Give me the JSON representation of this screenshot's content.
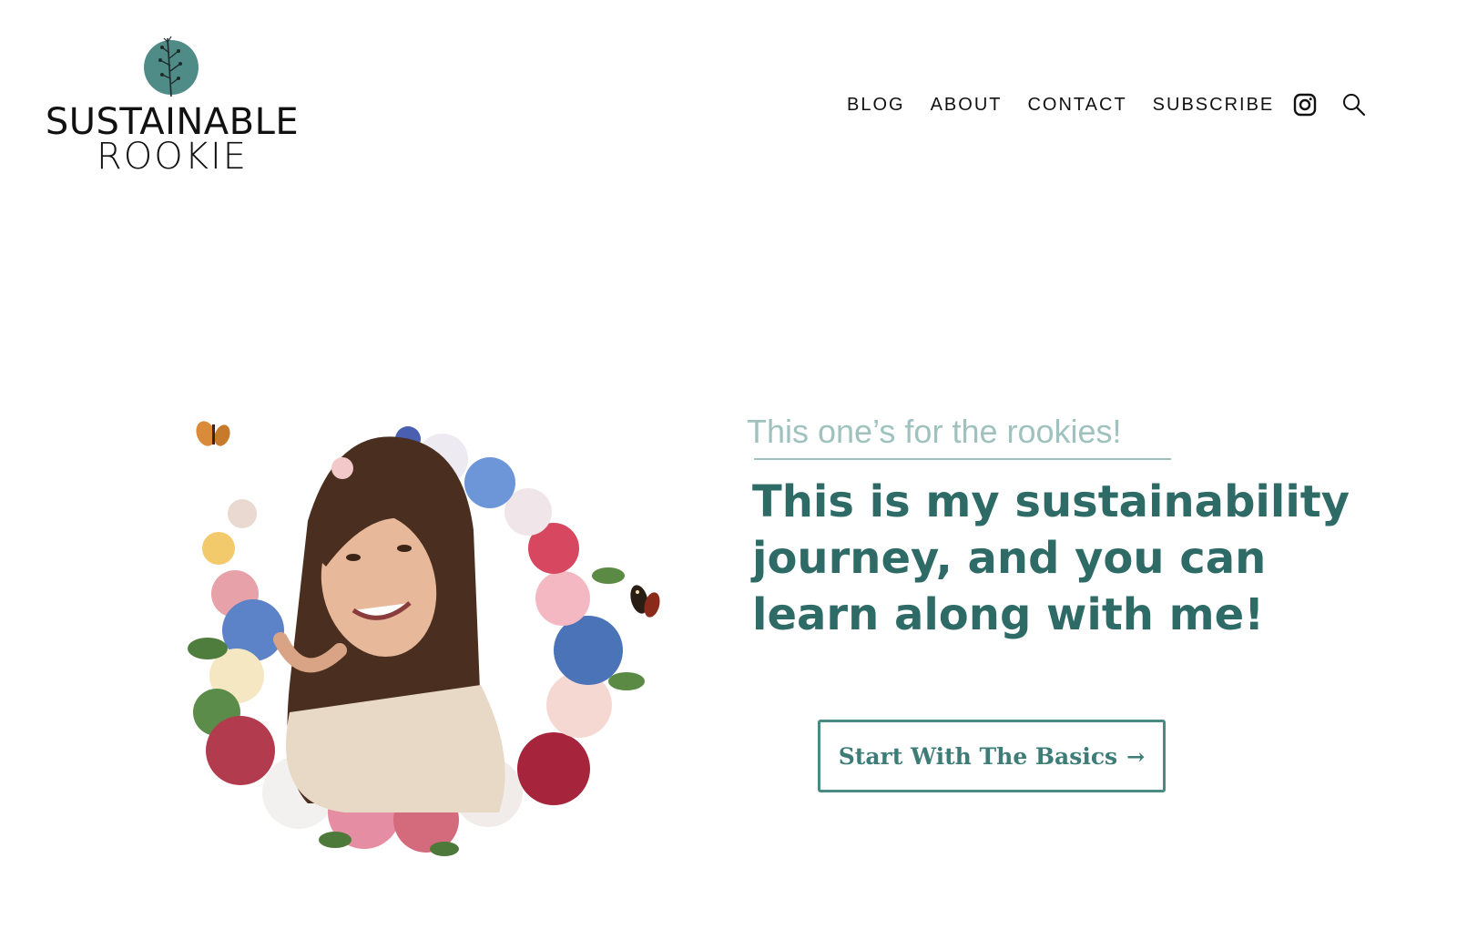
{
  "brand": {
    "line1": "SUSTAINABLE",
    "line2": "ROOKIE",
    "mark_color": "#4f8c88"
  },
  "nav": {
    "items": [
      {
        "label": "BLOG"
      },
      {
        "label": "ABOUT"
      },
      {
        "label": "CONTACT"
      },
      {
        "label": "SUBSCRIBE"
      }
    ],
    "icons": [
      "instagram-icon",
      "search-icon"
    ]
  },
  "hero": {
    "tagline": "This one’s for the rookies!",
    "headline": "This is my sustainability journey, and you can learn along with me!",
    "cta_label": "Start With The Basics",
    "cta_arrow": "→",
    "accent_color": "#2e6b67",
    "tagline_color": "#9fc2bf"
  }
}
